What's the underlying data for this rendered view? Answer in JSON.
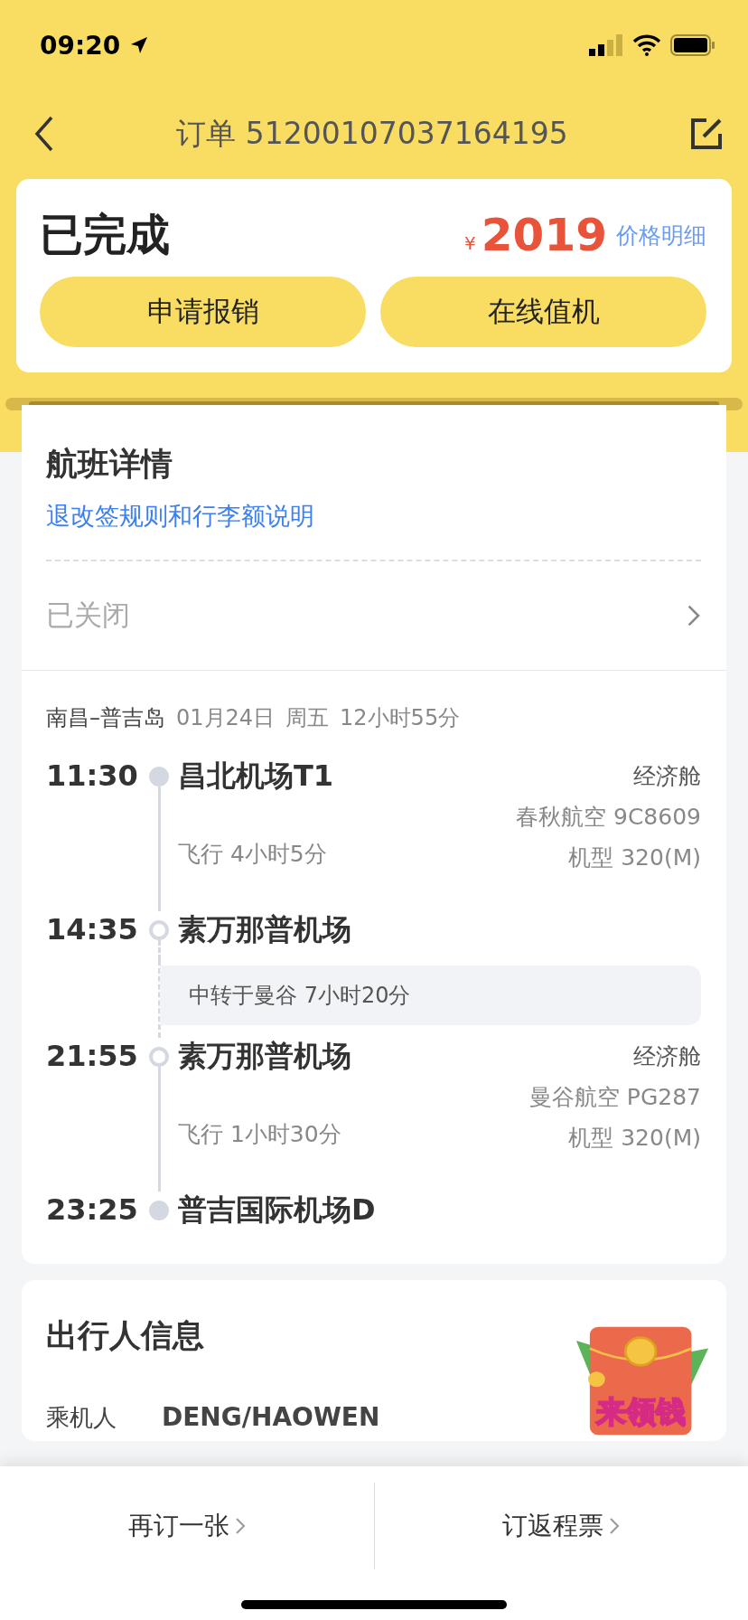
{
  "status_bar": {
    "time": "09:20"
  },
  "nav": {
    "title": "订单 51200107037164195"
  },
  "order": {
    "status": "已完成",
    "currency": "¥",
    "price": "2019",
    "price_link": "价格明细",
    "buttons": [
      "申请报销",
      "在线值机"
    ]
  },
  "flight": {
    "title": "航班详情",
    "rules_link": "退改签规则和行李额说明",
    "closed_row": "已关闭",
    "summary": {
      "route": "南昌–普吉岛",
      "date": "01月24日",
      "weekday": "周五",
      "duration": "12小时55分"
    },
    "timeline": [
      {
        "kind": "stop",
        "time": "11:30",
        "airport": "昌北机场T1",
        "endpoint": true,
        "cabin": "经济舱",
        "airline": "春秋航空 9C8609",
        "aircraft": "机型 320(M)",
        "flight_time": "飞行 4小时5分"
      },
      {
        "kind": "stop",
        "time": "14:35",
        "airport": "素万那普机场",
        "endpoint": false
      },
      {
        "kind": "transfer",
        "text": "中转于曼谷 7小时20分"
      },
      {
        "kind": "stop",
        "time": "21:55",
        "airport": "素万那普机场",
        "endpoint": false,
        "cabin": "经济舱",
        "airline": "曼谷航空 PG287",
        "aircraft": "机型 320(M)",
        "flight_time": "飞行 1小时30分"
      },
      {
        "kind": "stop",
        "time": "23:25",
        "airport": "普吉国际机场D",
        "endpoint": true
      }
    ]
  },
  "passengers": {
    "title": "出行人信息",
    "promo": "来领钱",
    "rows": [
      {
        "label": "乘机人",
        "value": "DENG/HAOWEN"
      }
    ]
  },
  "bottom_bar": {
    "actions": [
      "再订一张",
      "订返程票"
    ]
  }
}
